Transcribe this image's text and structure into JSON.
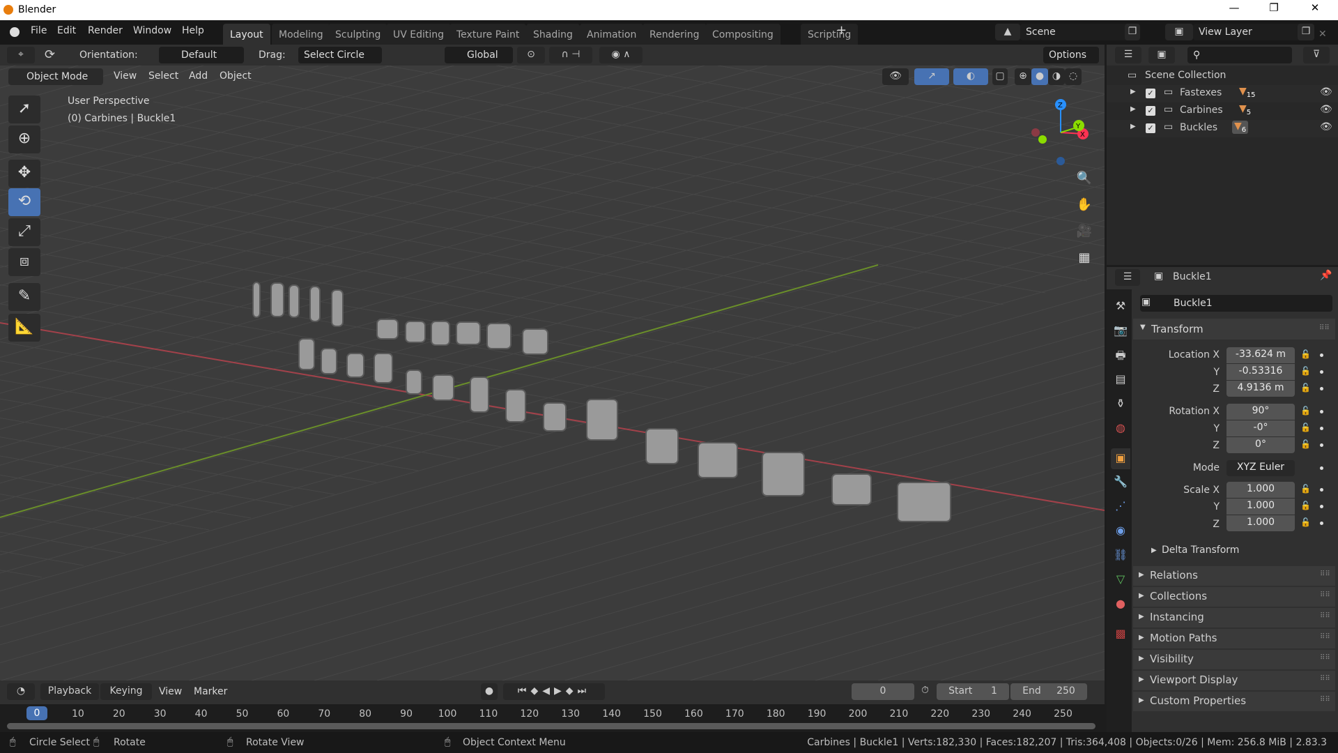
{
  "window": {
    "title": "Blender",
    "minimize": "—",
    "maximize": "❐",
    "close": "✕"
  },
  "menu": [
    "File",
    "Edit",
    "Render",
    "Window",
    "Help"
  ],
  "workspaces": [
    "Layout",
    "Modeling",
    "Sculpting",
    "UV Editing",
    "Texture Paint",
    "Shading",
    "Animation",
    "Rendering",
    "Compositing",
    "Scripting"
  ],
  "add_workspace": "+",
  "scene": {
    "name": "Scene",
    "view_layer": "View Layer"
  },
  "tool_header": {
    "orientation_label": "Orientation:",
    "orientation_value": "Default",
    "drag_label": "Drag:",
    "drag_value": "Select Circle",
    "transform_orientation": "Global",
    "options": "Options"
  },
  "viewport_header": {
    "mode": "Object Mode",
    "menus": [
      "View",
      "Select",
      "Add",
      "Object"
    ]
  },
  "viewport": {
    "perspective": "User Perspective",
    "context": "(0) Carbines | Buckle1",
    "gizmo_axes": [
      "X",
      "Y",
      "Z"
    ],
    "axis_colors": {
      "x": "#ff3352",
      "y": "#8bdc00",
      "z": "#2890ff"
    }
  },
  "outliner": {
    "root": "Scene Collection",
    "collections": [
      {
        "name": "Fastexes",
        "count": "15"
      },
      {
        "name": "Carbines",
        "count": "5"
      },
      {
        "name": "Buckles",
        "count": "6"
      }
    ]
  },
  "properties": {
    "header_object": "Buckle1",
    "object_name": "Buckle1",
    "transform_title": "Transform",
    "location_label": "Location X",
    "location": [
      "-33.624 m",
      "-0.53316",
      "4.9136 m"
    ],
    "rotation_label": "Rotation X",
    "rotation": [
      "90°",
      "-0°",
      "0°"
    ],
    "axis_labels": [
      "Y",
      "Z"
    ],
    "mode_label": "Mode",
    "mode_value": "XYZ Euler",
    "scale_label": "Scale X",
    "scale": [
      "1.000",
      "1.000",
      "1.000"
    ],
    "delta": "Delta Transform",
    "sections": [
      "Relations",
      "Collections",
      "Instancing",
      "Motion Paths",
      "Visibility",
      "Viewport Display",
      "Custom Properties"
    ]
  },
  "timeline": {
    "menus": [
      "Playback",
      "Keying",
      "View",
      "Marker"
    ],
    "current_frame": "0",
    "start_label": "Start",
    "start": "1",
    "end_label": "End",
    "end": "250",
    "ruler": [
      "0",
      "10",
      "20",
      "30",
      "40",
      "50",
      "60",
      "70",
      "80",
      "90",
      "100",
      "110",
      "120",
      "130",
      "140",
      "150",
      "160",
      "170",
      "180",
      "190",
      "200",
      "210",
      "220",
      "230",
      "240",
      "250"
    ]
  },
  "status": {
    "hints": [
      "Circle Select",
      "Rotate",
      "Rotate View",
      "Object Context Menu"
    ],
    "stats": "Carbines | Buckle1 | Verts:182,330 | Faces:182,207 | Tris:364,408 | Objects:0/26 | Mem: 256.8 MiB | 2.83.3"
  }
}
